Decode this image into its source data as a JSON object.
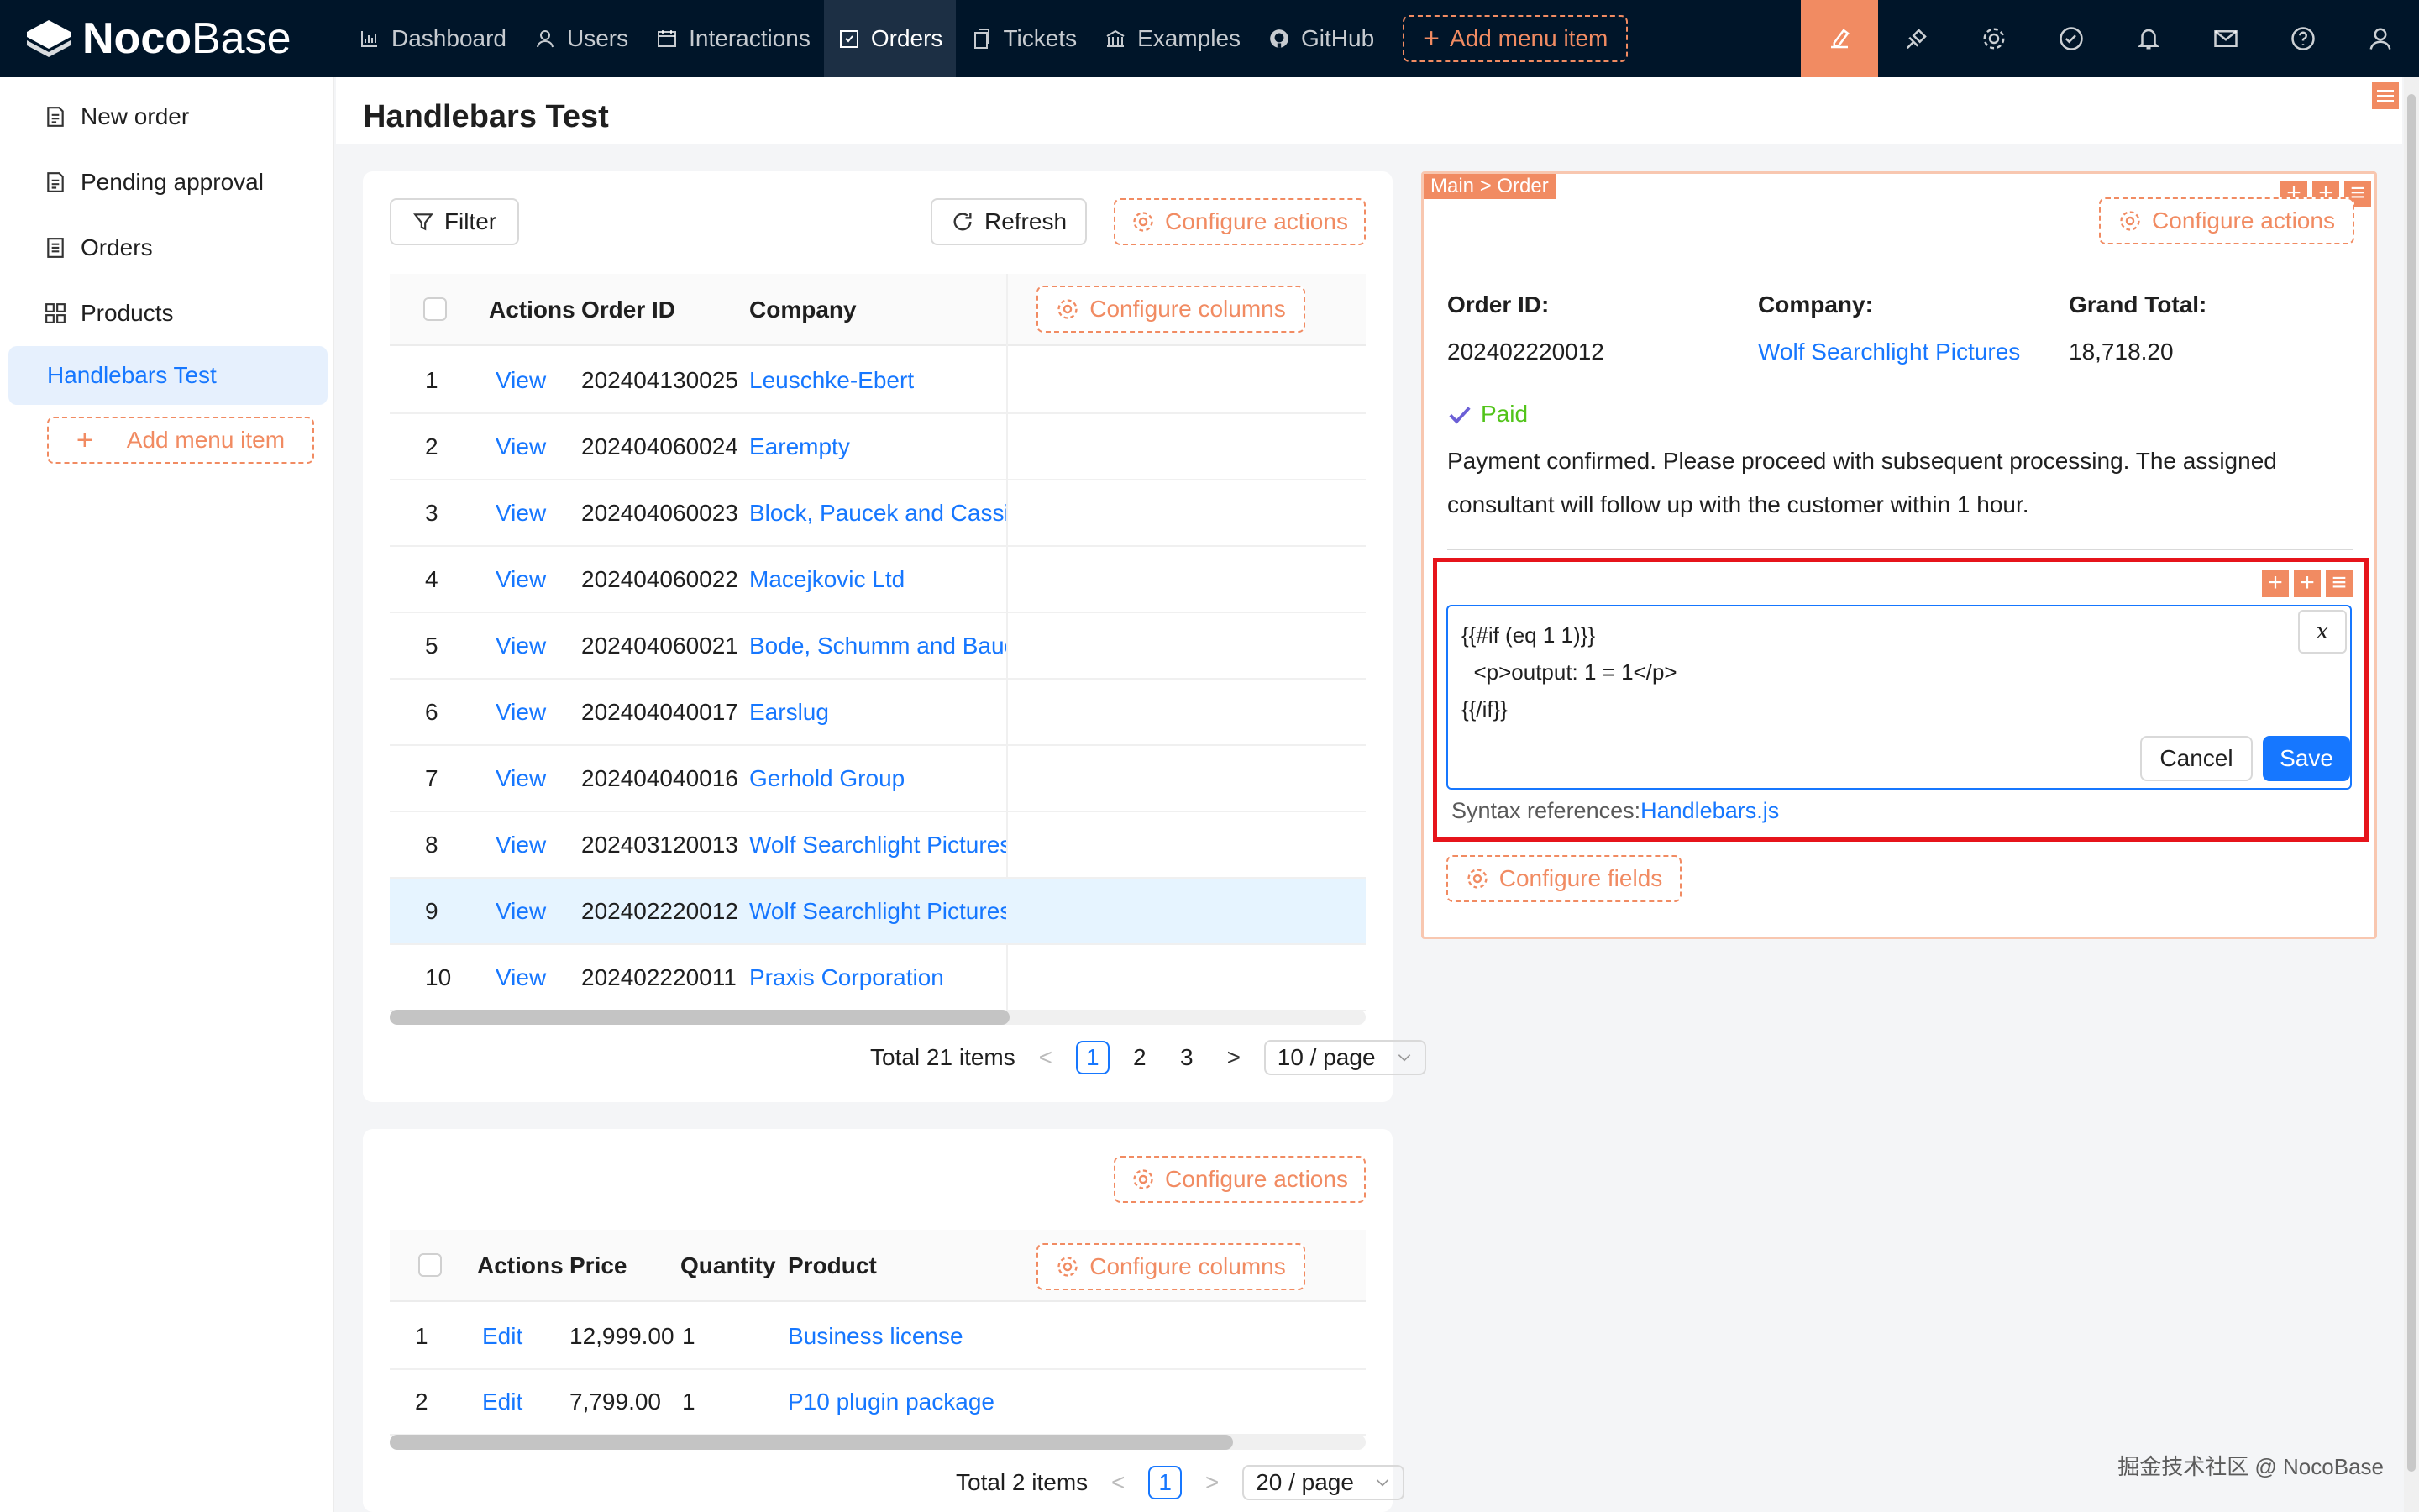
{
  "brand": {
    "name_bold": "Noco",
    "name_light": "Base"
  },
  "topnav": {
    "items": [
      {
        "label": "Dashboard",
        "icon": "bar-chart-icon"
      },
      {
        "label": "Users",
        "icon": "user-icon"
      },
      {
        "label": "Interactions",
        "icon": "calendar-icon"
      },
      {
        "label": "Orders",
        "icon": "order-icon",
        "active": true
      },
      {
        "label": "Tickets",
        "icon": "copy-icon"
      },
      {
        "label": "Examples",
        "icon": "bank-icon"
      },
      {
        "label": "GitHub",
        "icon": "github-icon"
      }
    ],
    "add_label": "Add menu item"
  },
  "sidebar": {
    "items": [
      {
        "label": "New order"
      },
      {
        "label": "Pending approval"
      },
      {
        "label": "Orders"
      },
      {
        "label": "Products"
      },
      {
        "label": "Handlebars Test",
        "active": true
      }
    ],
    "add_label": "Add menu item"
  },
  "page": {
    "title": "Handlebars Test"
  },
  "orders_table": {
    "filter_label": "Filter",
    "refresh_label": "Refresh",
    "configure_actions": "Configure actions",
    "configure_columns": "Configure columns",
    "columns": [
      "Actions",
      "Order ID",
      "Company"
    ],
    "rows": [
      {
        "n": "1",
        "action": "View",
        "order_id": "202404130025",
        "company": "Leuschke-Ebert"
      },
      {
        "n": "2",
        "action": "View",
        "order_id": "202404060024",
        "company": "Earempty"
      },
      {
        "n": "3",
        "action": "View",
        "order_id": "202404060023",
        "company": "Block, Paucek and Cassin"
      },
      {
        "n": "4",
        "action": "View",
        "order_id": "202404060022",
        "company": "Macejkovic Ltd"
      },
      {
        "n": "5",
        "action": "View",
        "order_id": "202404060021",
        "company": "Bode, Schumm and Bauch"
      },
      {
        "n": "6",
        "action": "View",
        "order_id": "202404040017",
        "company": "Earslug"
      },
      {
        "n": "7",
        "action": "View",
        "order_id": "202404040016",
        "company": "Gerhold Group"
      },
      {
        "n": "8",
        "action": "View",
        "order_id": "202403120013",
        "company": "Wolf Searchlight Pictures"
      },
      {
        "n": "9",
        "action": "View",
        "order_id": "202402220012",
        "company": "Wolf Searchlight Pictures",
        "selected": true
      },
      {
        "n": "10",
        "action": "View",
        "order_id": "202402220011",
        "company": "Praxis Corporation"
      }
    ],
    "total": "Total 21 items",
    "pages": [
      "1",
      "2",
      "3"
    ],
    "current_page": "1",
    "page_size": "10 / page"
  },
  "items_table": {
    "configure_actions": "Configure actions",
    "configure_columns": "Configure columns",
    "columns": [
      "Actions",
      "Price",
      "Quantity",
      "Product"
    ],
    "rows": [
      {
        "n": "1",
        "action": "Edit",
        "price": "12,999.00",
        "qty": "1",
        "product": "Business license"
      },
      {
        "n": "2",
        "action": "Edit",
        "price": "7,799.00",
        "qty": "1",
        "product": "P10 plugin package"
      }
    ],
    "total": "Total 2 items",
    "current_page": "1",
    "page_size": "20 / page"
  },
  "details": {
    "crumb": "Main > Order",
    "configure_actions": "Configure actions",
    "fields": [
      {
        "label": "Order ID",
        "value": "202402220012"
      },
      {
        "label": "Company",
        "value": "Wolf Searchlight Pictures"
      },
      {
        "label": "Grand Total",
        "value": "18,718.20"
      }
    ],
    "status": "Paid",
    "description_line1": "Payment confirmed. Please proceed with subsequent processing. The assigned",
    "description_line2": "consultant will follow up with the customer within 1 hour.",
    "editor": {
      "code": "{{#if (eq 1 1)}}\n  <p>output: 1 = 1</p>\n{{/if}}",
      "variable_button": "x",
      "cancel_label": "Cancel",
      "save_label": "Save",
      "syntax_prefix": "Syntax references:",
      "syntax_link": "Handlebars.js"
    },
    "configure_fields": "Configure fields"
  },
  "watermark": "掘金技术社区 @ NocoBase",
  "colors": {
    "nav_bg": "#001529",
    "accent": "#f18b62",
    "primary": "#1677ff",
    "highlight_border": "#e6141b",
    "paid": "#52c41a"
  }
}
